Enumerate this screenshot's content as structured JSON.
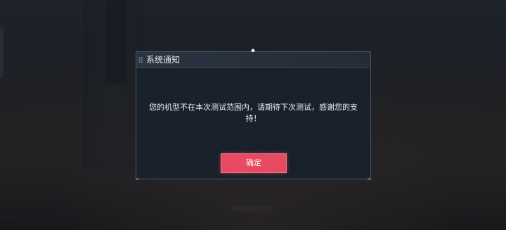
{
  "dialog": {
    "title": "系统通知",
    "message": "您的机型不在本次测试范围内，请期待下次测试，感谢您的支持！",
    "confirm_label": "确定"
  },
  "icons": {
    "header_grip": "grip-dots-icon",
    "top_marker": "pin-marker-icon"
  },
  "colors": {
    "confirm_button": "#e84a62",
    "dialog_background": "#1b222c",
    "dialog_border": "#4d5666",
    "text": "#eef1f5"
  }
}
